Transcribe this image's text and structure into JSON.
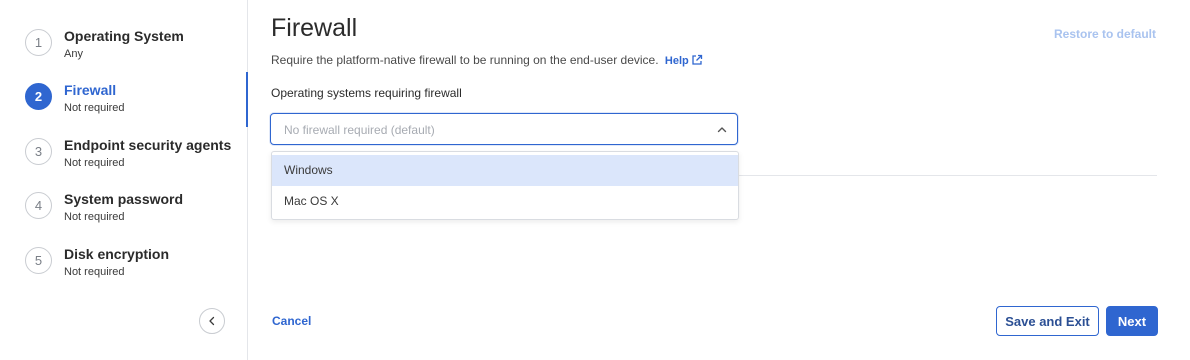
{
  "sidebar": {
    "steps": [
      {
        "number": "1",
        "title": "Operating System",
        "subtitle": "Any"
      },
      {
        "number": "2",
        "title": "Firewall",
        "subtitle": "Not required"
      },
      {
        "number": "3",
        "title": "Endpoint security agents",
        "subtitle": "Not required"
      },
      {
        "number": "4",
        "title": "System password",
        "subtitle": "Not required"
      },
      {
        "number": "5",
        "title": "Disk encryption",
        "subtitle": "Not required"
      }
    ],
    "active_step": 2,
    "collapse_icon": "chevron-left-icon"
  },
  "main": {
    "title": "Firewall",
    "restore_label": "Restore to default",
    "description": "Require the platform-native firewall to be running on the end-user device.",
    "help_label": "Help",
    "help_icon": "external-link-icon",
    "field_label": "Operating systems requiring firewall",
    "select": {
      "placeholder": "No firewall required (default)",
      "expanded": true,
      "chevron_icon": "chevron-up-icon",
      "options": [
        "Windows",
        "Mac OS X"
      ],
      "highlighted_option": "Windows"
    }
  },
  "footer": {
    "cancel_label": "Cancel",
    "save_exit_label": "Save and Exit",
    "next_label": "Next"
  },
  "colors": {
    "accent": "#2f66d0",
    "restore_disabled": "#a9c3ef",
    "option_highlight": "#dbe6fb"
  }
}
